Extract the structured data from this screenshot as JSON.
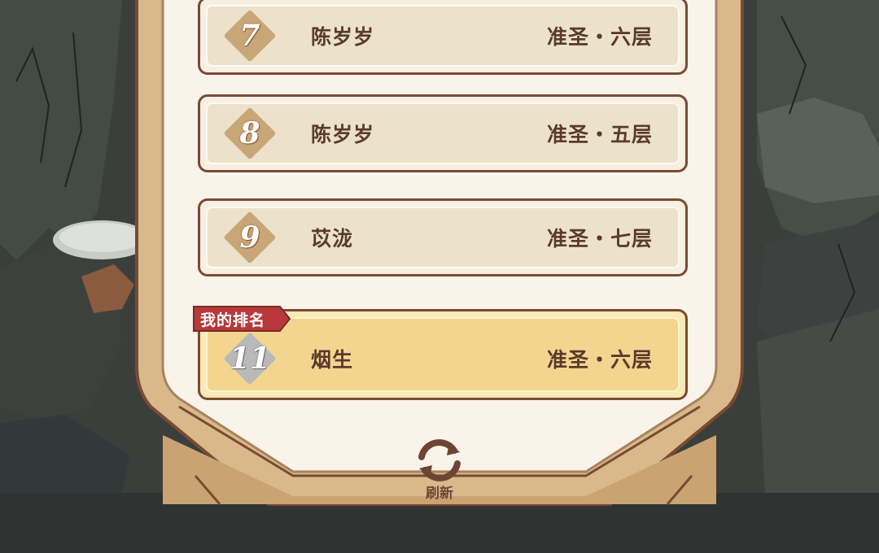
{
  "leaderboard": {
    "rows": [
      {
        "rank": "7",
        "name": "陈岁岁",
        "realm": "准圣・六层"
      },
      {
        "rank": "8",
        "name": "陈岁岁",
        "realm": "准圣・五层"
      },
      {
        "rank": "9",
        "name": "苡泷",
        "realm": "准圣・七层"
      }
    ],
    "my_row": {
      "tag": "我的排名",
      "rank": "11",
      "name": "烟生",
      "realm": "准圣・六层"
    }
  },
  "refresh": {
    "label": "刷新",
    "icon": "refresh-icon"
  },
  "colors": {
    "frame_wood": "#d9b98a",
    "frame_outline": "#7a4a33",
    "row_bg": "#ece2cc",
    "my_row_bg": "#f3d58f",
    "tag_red": "#b8383b",
    "text_brown": "#5a3a2c"
  }
}
